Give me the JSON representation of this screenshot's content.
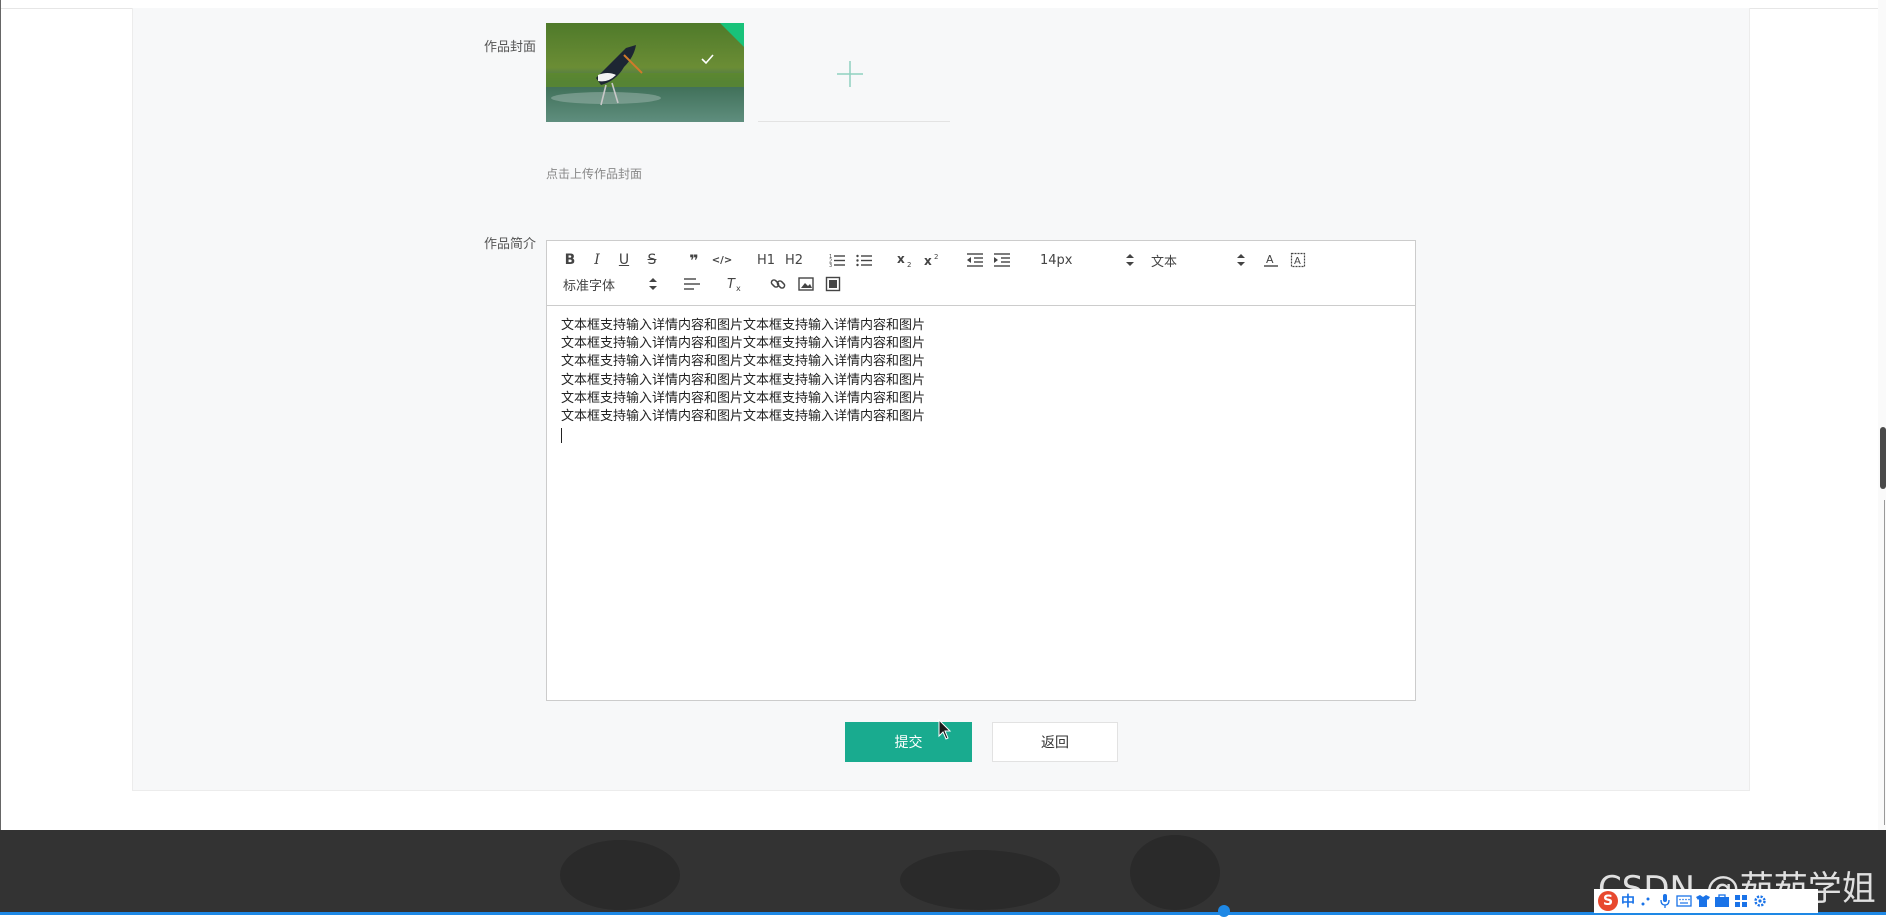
{
  "form": {
    "cover_label": "作品封面",
    "cover_upload_hint": "点击上传作品封面",
    "intro_label": "作品简介"
  },
  "editor": {
    "toolbar": {
      "row1": [
        {
          "name": "bold",
          "glyph": "B"
        },
        {
          "name": "italic",
          "glyph": "I"
        },
        {
          "name": "underline",
          "glyph": "U"
        },
        {
          "name": "strike",
          "glyph": "S"
        },
        {
          "name": "blockquote",
          "glyph": "❞"
        },
        {
          "name": "code-block",
          "glyph": "</>"
        },
        {
          "name": "header-1",
          "glyph": "H1"
        },
        {
          "name": "header-2",
          "glyph": "H2"
        },
        {
          "name": "ordered-list",
          "glyph": "ol"
        },
        {
          "name": "bullet-list",
          "glyph": "ul"
        },
        {
          "name": "subscript",
          "glyph": "x2"
        },
        {
          "name": "superscript",
          "glyph": "x2"
        },
        {
          "name": "indent-decrease",
          "glyph": "outdent"
        },
        {
          "name": "indent-increase",
          "glyph": "indent"
        }
      ],
      "size_value": "14px",
      "header_value": "文本",
      "font_value": "标准字体"
    },
    "lines": [
      "文本框支持输入详情内容和图片文本框支持输入详情内容和图片",
      "文本框支持输入详情内容和图片文本框支持输入详情内容和图片",
      "文本框支持输入详情内容和图片文本框支持输入详情内容和图片",
      "文本框支持输入详情内容和图片文本框支持输入详情内容和图片",
      "文本框支持输入详情内容和图片文本框支持输入详情内容和图片",
      "文本框支持输入详情内容和图片文本框支持输入详情内容和图片"
    ]
  },
  "actions": {
    "submit_label": "提交",
    "back_label": "返回"
  },
  "colors": {
    "primary": "#19ab8f",
    "footer": "#333333",
    "panel": "#f7f8f9"
  },
  "watermark": "CSDN @茹茹学姐",
  "ime": {
    "logo": "S",
    "mode": "中"
  }
}
